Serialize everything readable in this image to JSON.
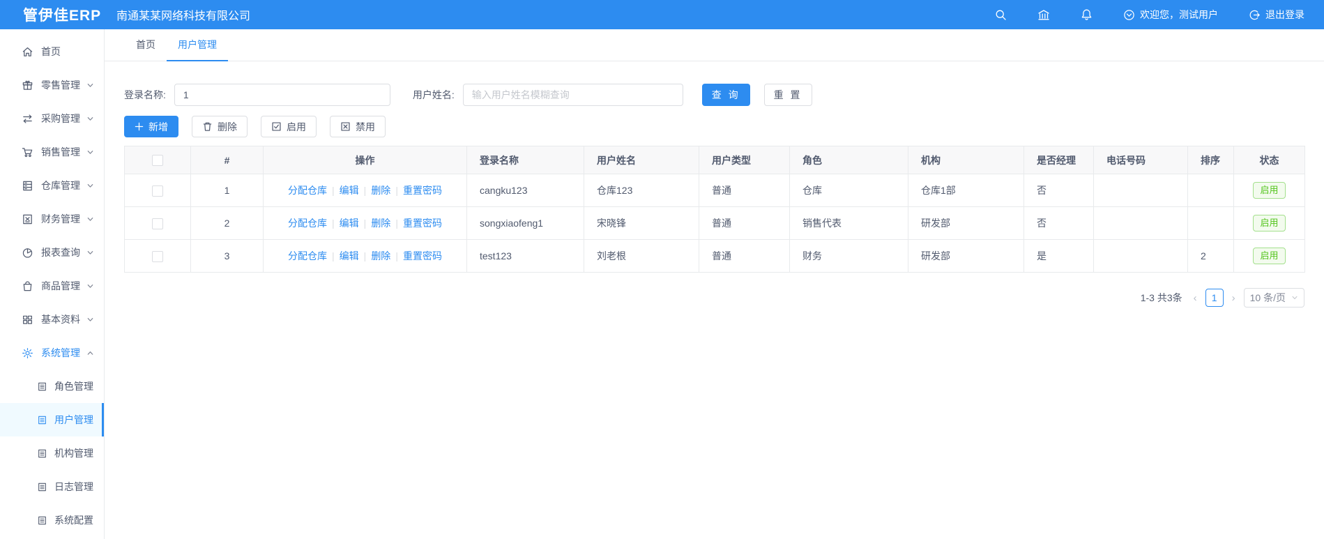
{
  "colors": {
    "primary": "#2d8cf0",
    "success_text": "#52c41a",
    "success_border": "#a3e08c",
    "success_bg": "#f3fbee",
    "header_bg": "#2d8cf0"
  },
  "header": {
    "logo": "管伊佳ERP",
    "company": "南通某某网络科技有限公司",
    "icon_names": [
      "search",
      "bank",
      "bell",
      "user-circle-down",
      "logout"
    ],
    "welcome": "欢迎您，测试用户",
    "logout_label": "退出登录"
  },
  "tabs": [
    {
      "label": "首页",
      "active": false
    },
    {
      "label": "用户管理",
      "active": true
    }
  ],
  "sidebar": {
    "items": [
      {
        "label": "首页",
        "icon": "home"
      },
      {
        "label": "零售管理",
        "icon": "gift",
        "chevron": "down"
      },
      {
        "label": "采购管理",
        "icon": "swap",
        "chevron": "down"
      },
      {
        "label": "销售管理",
        "icon": "cart",
        "chevron": "down"
      },
      {
        "label": "仓库管理",
        "icon": "archive",
        "chevron": "down"
      },
      {
        "label": "财务管理",
        "icon": "finance",
        "chevron": "down"
      },
      {
        "label": "报表查询",
        "icon": "pie-chart",
        "chevron": "down"
      },
      {
        "label": "商品管理",
        "icon": "bag",
        "chevron": "down"
      },
      {
        "label": "基本资料",
        "icon": "grid",
        "chevron": "down"
      },
      {
        "label": "系统管理",
        "icon": "gear",
        "chevron": "up",
        "active": true
      }
    ],
    "system_children": [
      {
        "label": "角色管理",
        "icon": "doc",
        "active": false
      },
      {
        "label": "用户管理",
        "icon": "doc",
        "active": true
      },
      {
        "label": "机构管理",
        "icon": "doc",
        "active": false
      },
      {
        "label": "日志管理",
        "icon": "doc",
        "active": false
      },
      {
        "label": "系统配置",
        "icon": "doc",
        "active": false
      }
    ]
  },
  "search": {
    "login_label": "登录名称:",
    "login_value": "1",
    "name_label": "用户姓名:",
    "name_placeholder": "输入用户姓名模糊查询",
    "query_label": "查 询",
    "reset_label": "重 置"
  },
  "toolbar": {
    "add_label": "新增",
    "delete_label": "删除",
    "enable_label": "启用",
    "disable_label": "禁用"
  },
  "table": {
    "headers": [
      "#",
      "操作",
      "登录名称",
      "用户姓名",
      "用户类型",
      "角色",
      "机构",
      "是否经理",
      "电话号码",
      "排序",
      "状态"
    ],
    "action_links": [
      "分配仓库",
      "编辑",
      "删除",
      "重置密码"
    ],
    "rows": [
      {
        "index": "1",
        "login": "cangku123",
        "name": "仓库123",
        "type": "普通",
        "role": "仓库",
        "org": "仓库1部",
        "manager": "否",
        "phone": "",
        "sort": "",
        "status": "启用"
      },
      {
        "index": "2",
        "login": "songxiaofeng1",
        "name": "宋晓锋",
        "type": "普通",
        "role": "销售代表",
        "org": "研发部",
        "manager": "否",
        "phone": "",
        "sort": "",
        "status": "启用"
      },
      {
        "index": "3",
        "login": "test123",
        "name": "刘老根",
        "type": "普通",
        "role": "财务",
        "org": "研发部",
        "manager": "是",
        "phone": "",
        "sort": "2",
        "status": "启用"
      }
    ]
  },
  "pagination": {
    "range": "1-3 共3条",
    "prev": "‹",
    "page": "1",
    "next": "›",
    "page_size": "10 条/页"
  }
}
